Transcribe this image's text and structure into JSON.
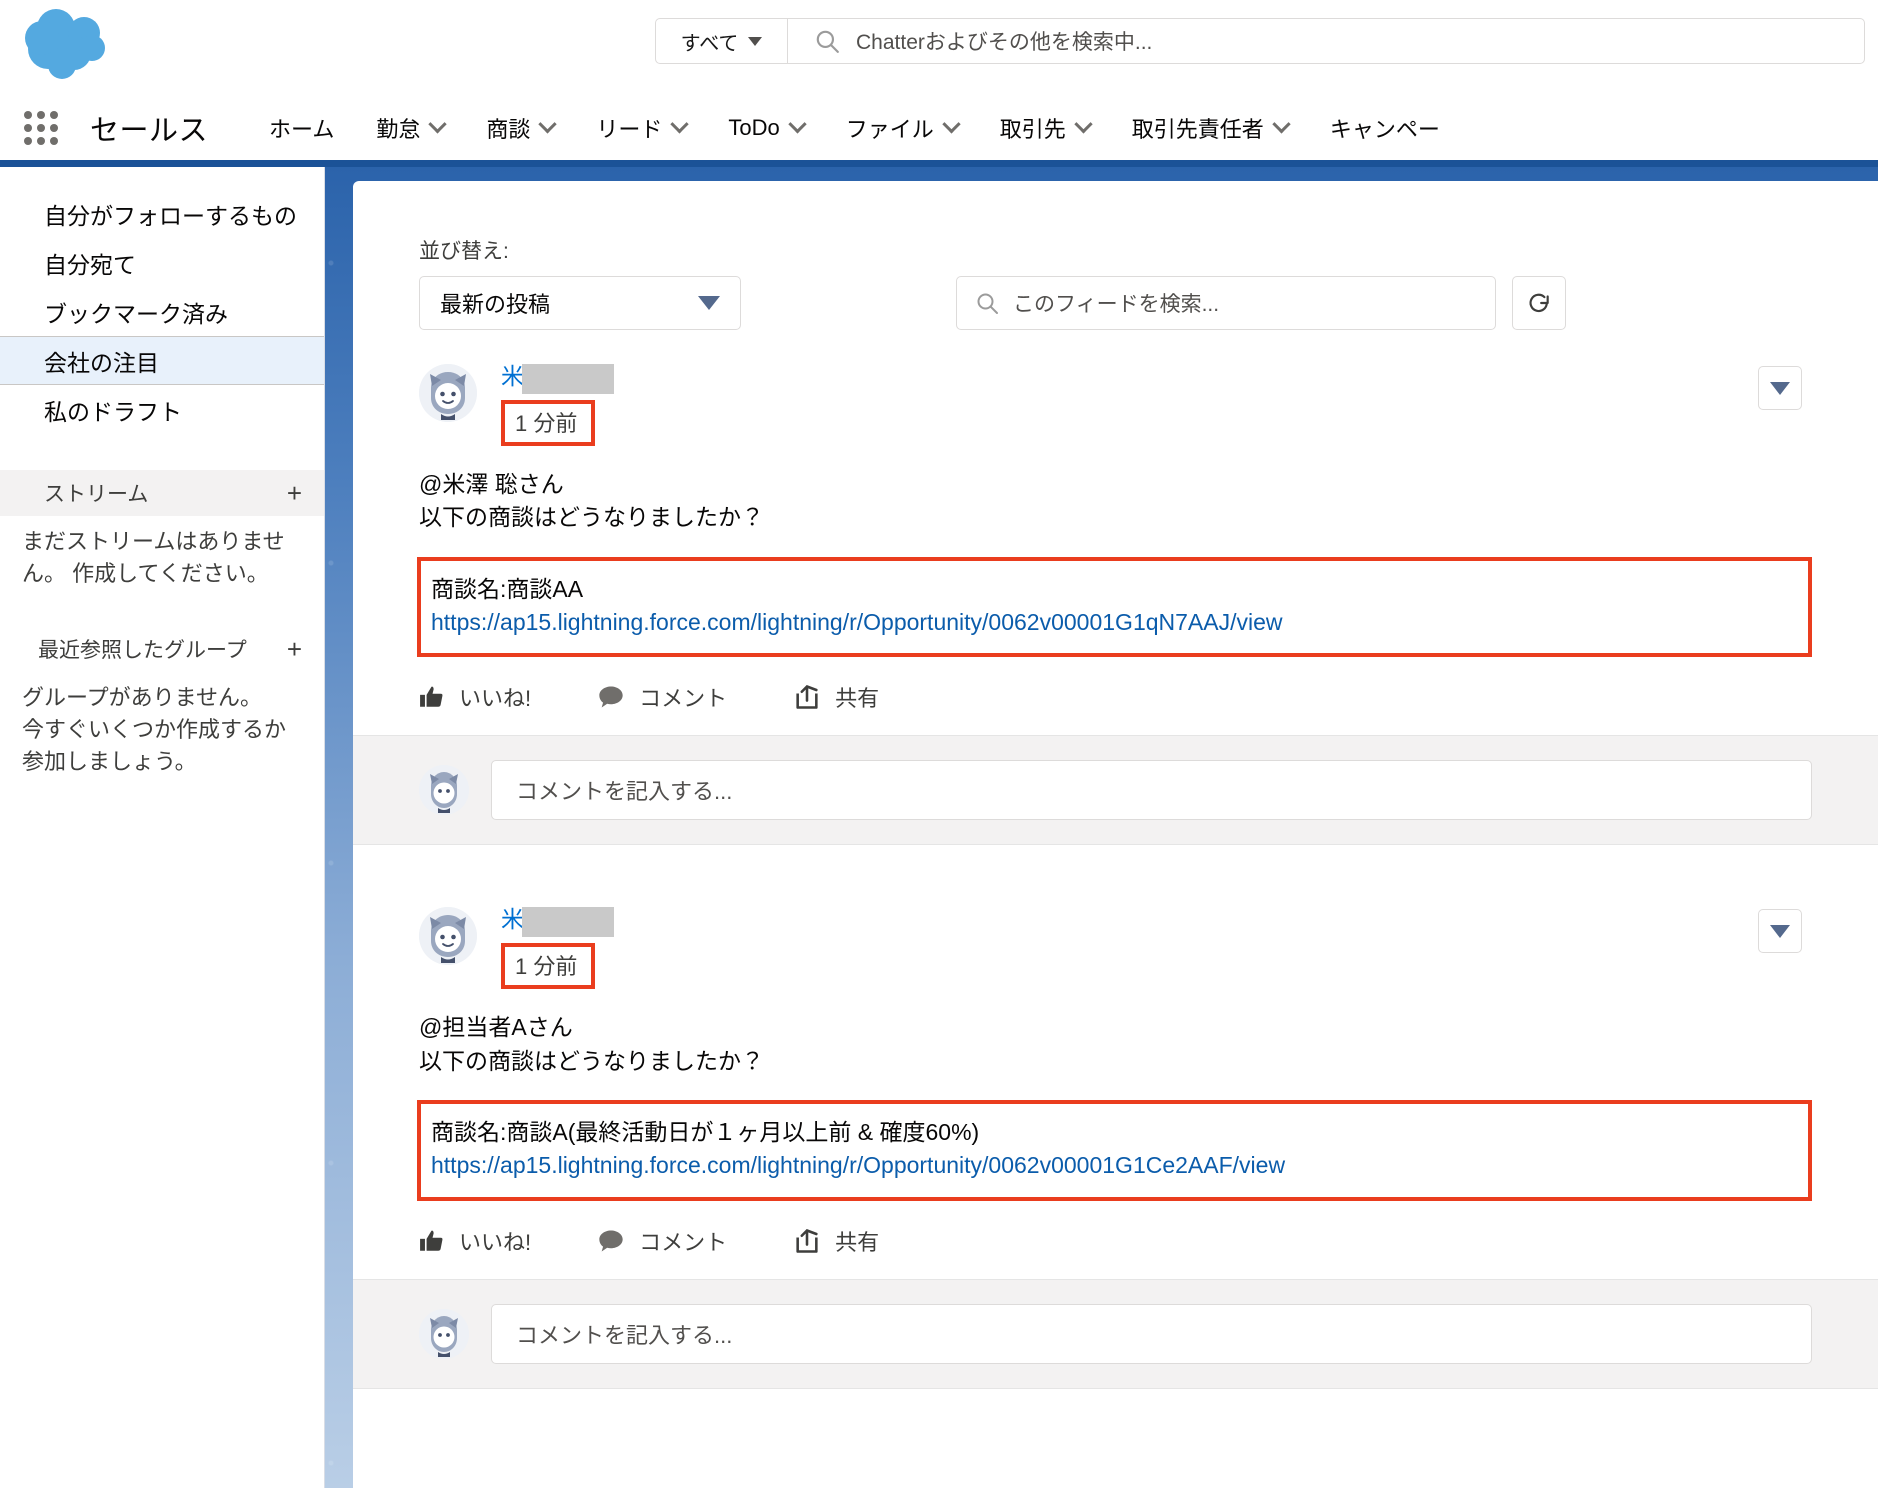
{
  "header": {
    "logo_icon": "salesforce-cloud-logo",
    "search": {
      "scope_label": "すべて",
      "scope_caret_icon": "caret-down-icon",
      "search_icon": "search-icon",
      "placeholder": "Chatterおよびその他を検索中..."
    }
  },
  "nav": {
    "app_launcher_icon": "app-launcher-icon",
    "app_name": "セールス",
    "items": [
      {
        "label": "ホーム",
        "has_menu": false
      },
      {
        "label": "勤怠",
        "has_menu": true
      },
      {
        "label": "商談",
        "has_menu": true
      },
      {
        "label": "リード",
        "has_menu": true
      },
      {
        "label": "ToDo",
        "has_menu": true
      },
      {
        "label": "ファイル",
        "has_menu": true
      },
      {
        "label": "取引先",
        "has_menu": true
      },
      {
        "label": "取引先責任者",
        "has_menu": true
      },
      {
        "label": "キャンペー",
        "has_menu": false
      }
    ],
    "accent_color": "#1b5297"
  },
  "sidebar": {
    "items": [
      {
        "label": "自分がフォローするもの",
        "active": false
      },
      {
        "label": "自分宛て",
        "active": false
      },
      {
        "label": "ブックマーク済み",
        "active": false
      },
      {
        "label": "会社の注目",
        "active": true
      },
      {
        "label": "私のドラフト",
        "active": false
      }
    ],
    "streams": {
      "title": "ストリーム",
      "add_icon": "plus-icon",
      "empty_text": "まだストリームはありません。 作成してください。"
    },
    "groups": {
      "title": "最近参照したグループ",
      "add_icon": "plus-icon",
      "empty_text": "グループがありません。 今すぐいくつか作成するか参加しましょう。"
    }
  },
  "feed": {
    "toolbar": {
      "sort_label": "並び替え:",
      "sort_value": "最新の投稿",
      "sort_caret_icon": "caret-down-icon",
      "search_icon": "search-icon",
      "search_placeholder": "このフィードを検索...",
      "refresh_icon": "refresh-icon"
    },
    "actions": {
      "like_label": "いいね!",
      "like_icon": "thumbs-up-icon",
      "comment_label": "コメント",
      "comment_icon": "speech-bubble-icon",
      "share_label": "共有",
      "share_icon": "share-icon"
    },
    "comment_placeholder": "コメントを記入する...",
    "menu_icon": "caret-down-icon",
    "highlight_color": "#ea3d1e",
    "posts": [
      {
        "author_visible": "米",
        "author_redacted": true,
        "timestamp": "1 分前",
        "mention": "@米澤 聡さん",
        "body": "以下の商談はどうなりましたか？",
        "opportunity_name": "商談名:商談AA",
        "opportunity_url": "https://ap15.lightning.force.com/lightning/r/Opportunity/0062v00001G1qN7AAJ/view"
      },
      {
        "author_visible": "米",
        "author_redacted": true,
        "timestamp": "1 分前",
        "mention": "@担当者Aさん",
        "body": "以下の商談はどうなりましたか？",
        "opportunity_name": "商談名:商談A(最終活動日が１ヶ月以上前 & 確度60%)",
        "opportunity_url": "https://ap15.lightning.force.com/lightning/r/Opportunity/0062v00001G1Ce2AAF/view"
      }
    ]
  }
}
